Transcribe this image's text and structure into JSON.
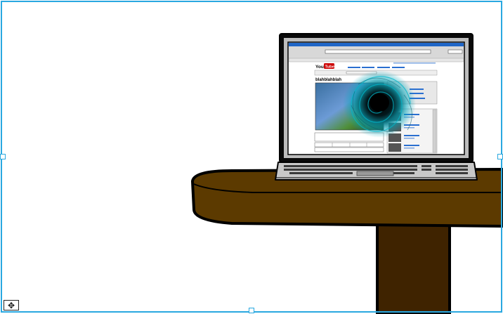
{
  "illustration": {
    "logo_you": "You",
    "logo_tube": "Tube",
    "video_title": "blahblahblah",
    "blah_link": "blahblahblah",
    "colors": {
      "frame_accent": "#29a8e0",
      "table_top": "#5c3a00",
      "table_leg": "#3f2300",
      "laptop_bezel": "#0a0a0a",
      "laptop_body": "#c8c8c8",
      "youtube_red": "#cc0000",
      "browser_bar": "#1f66c7",
      "vortex": "#00a3b8"
    }
  },
  "controls": {
    "move_icon": "move-icon",
    "move_glyph": "✥"
  }
}
